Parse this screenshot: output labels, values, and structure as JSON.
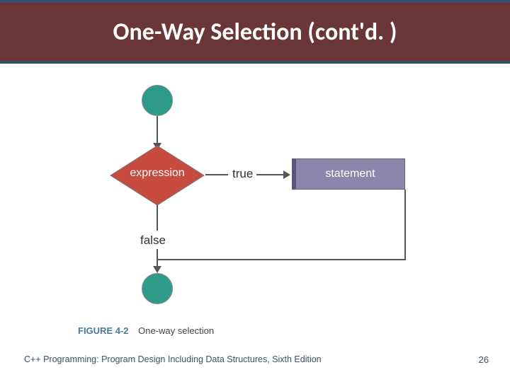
{
  "header": {
    "title": "One-Way Selection (cont'd. )"
  },
  "diagram": {
    "decision_label": "expression",
    "true_label": "true",
    "false_label": "false",
    "statement_label": "statement",
    "figure_number": "FIGURE 4-2",
    "figure_caption": "One-way selection"
  },
  "footer": {
    "text": "C++ Programming: Program Design Including Data Structures, Sixth Edition",
    "page": "26"
  },
  "colors": {
    "header_bg": "#6b3636",
    "header_border": "#3a5068",
    "circle": "#2e9b8a",
    "diamond": "#c84b3f",
    "box": "#8b87aa"
  }
}
